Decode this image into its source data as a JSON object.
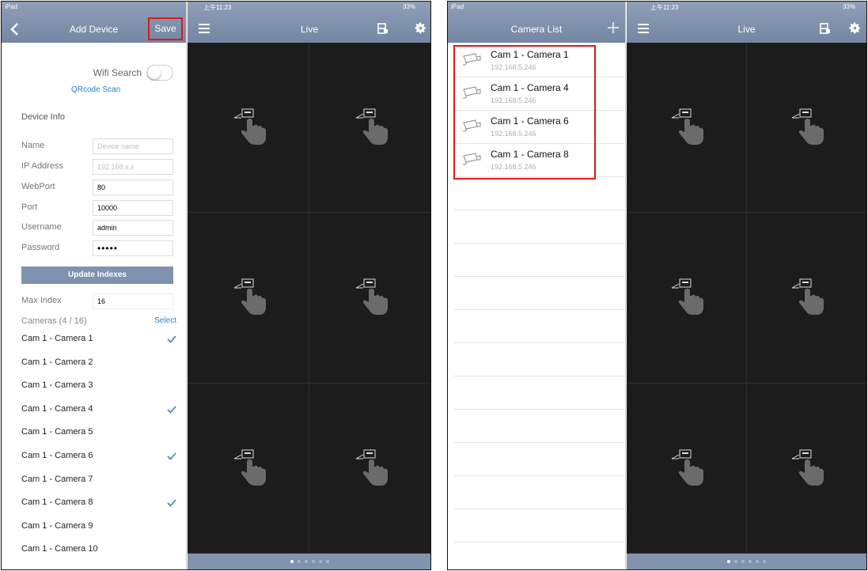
{
  "left_screen": {
    "status": {
      "device": "iPad",
      "time": "上午11:23",
      "battery": "33%"
    },
    "add_device": {
      "title": "Add Device",
      "save_label": "Save",
      "wifi_search_label": "Wifi Search",
      "qrcode_label": "QRcode Scan",
      "device_info_label": "Device Info",
      "fields": [
        {
          "label": "Name",
          "value": "",
          "placeholder": "Device name"
        },
        {
          "label": "IP Address",
          "value": "",
          "placeholder": "192.168.x.x"
        },
        {
          "label": "WebPort",
          "value": "80",
          "placeholder": ""
        },
        {
          "label": "Port",
          "value": "10000",
          "placeholder": ""
        },
        {
          "label": "Username",
          "value": "admin",
          "placeholder": ""
        },
        {
          "label": "Password",
          "value": "•••••",
          "placeholder": ""
        }
      ],
      "update_label": "Update Indexes",
      "max_index_label": "Max Index",
      "max_index_value": "16",
      "cameras_label": "Cameras (4 / 16)",
      "select_label": "Select",
      "cameras": [
        {
          "name": "Cam 1 - Camera 1",
          "checked": true
        },
        {
          "name": "Cam 1 - Camera 2",
          "checked": false
        },
        {
          "name": "Cam 1 - Camera 3",
          "checked": false
        },
        {
          "name": "Cam 1 - Camera 4",
          "checked": true
        },
        {
          "name": "Cam 1 - Camera 5",
          "checked": false
        },
        {
          "name": "Cam 1 - Camera 6",
          "checked": true
        },
        {
          "name": "Cam 1 - Camera 7",
          "checked": false
        },
        {
          "name": "Cam 1 - Camera 8",
          "checked": true
        },
        {
          "name": "Cam 1 - Camera 9",
          "checked": false
        },
        {
          "name": "Cam 1 - Camera 10",
          "checked": false
        }
      ]
    },
    "live": {
      "title": "Live",
      "pages": 6,
      "active_page": 0
    }
  },
  "right_screen": {
    "status": {
      "device": "iPad",
      "time": "上午11:23",
      "battery": "33%"
    },
    "camera_list": {
      "title": "Camera List",
      "cameras": [
        {
          "name": "Cam 1 - Camera 1",
          "ip": "192.168.5.246"
        },
        {
          "name": "Cam 1 - Camera 4",
          "ip": "192.168.5.246"
        },
        {
          "name": "Cam 1 - Camera 6",
          "ip": "192.168.5.246"
        },
        {
          "name": "Cam 1 - Camera 8",
          "ip": "192.168.5.246"
        }
      ]
    },
    "live": {
      "title": "Live",
      "pages": 6,
      "active_page": 0
    }
  },
  "colors": {
    "navbar": "#7f90ac",
    "highlight": "#e01818",
    "link": "#2b7fc6",
    "live_bg": "#1c1c1c"
  }
}
